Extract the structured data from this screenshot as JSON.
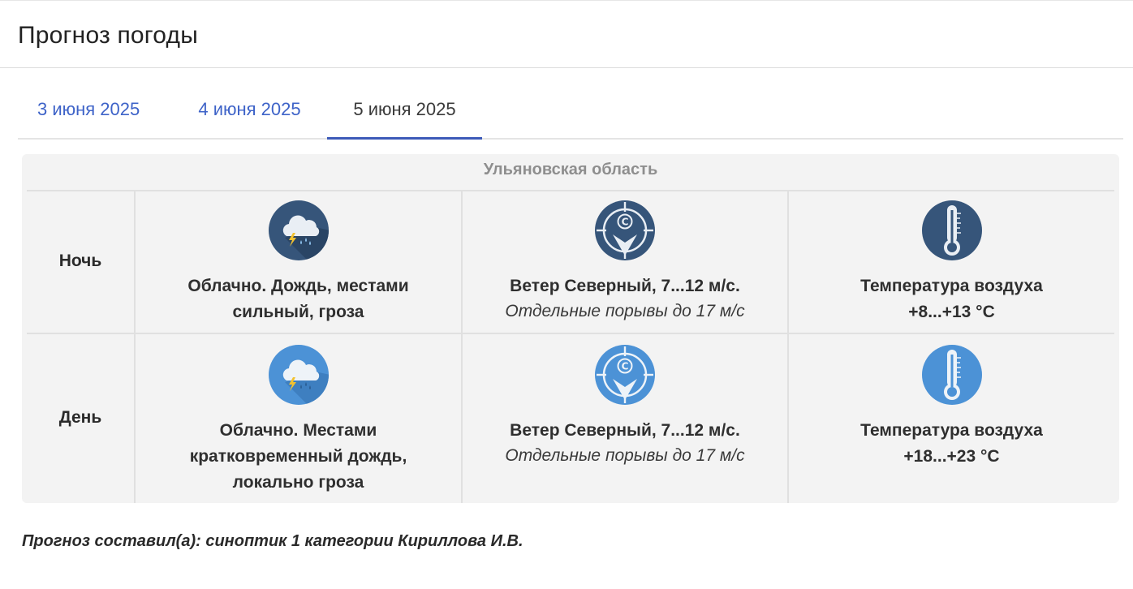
{
  "page": {
    "title": "Прогноз погоды"
  },
  "tabs": [
    {
      "label": "3 июня 2025",
      "active": false
    },
    {
      "label": "4 июня 2025",
      "active": false
    },
    {
      "label": "5 июня 2025",
      "active": true
    }
  ],
  "forecast": {
    "region": "Ульяновская область",
    "rows": [
      {
        "period": "Ночь",
        "weather": {
          "icon": "cloud-rain-thunder-icon",
          "text": "Облачно. Дождь, местами сильный, гроза"
        },
        "wind": {
          "icon": "wind-north-compass-icon",
          "direction_letter": "С",
          "text": "Ветер Северный, 7...12 м/с.",
          "gusts": "Отдельные порывы до 17 м/с"
        },
        "temperature": {
          "icon": "thermometer-icon",
          "label": "Температура воздуха",
          "value": "+8...+13 °C"
        }
      },
      {
        "period": "День",
        "weather": {
          "icon": "cloud-rain-thunder-icon",
          "text": "Облачно. Местами кратковременный дождь, локально гроза"
        },
        "wind": {
          "icon": "wind-north-compass-icon",
          "direction_letter": "С",
          "text": "Ветер Северный, 7...12 м/с.",
          "gusts": "Отдельные порывы до 17 м/с"
        },
        "temperature": {
          "icon": "thermometer-icon",
          "label": "Температура воздуха",
          "value": "+18...+23 °C"
        }
      }
    ]
  },
  "footer": {
    "author": "Прогноз составил(а): синоптик 1 категории Кириллова И.В."
  },
  "colors": {
    "tab_link": "#3e63c8",
    "tab_underline": "#3d5ab8",
    "night_icon": "#36557a",
    "day_icon": "#4c92d6",
    "panel_bg": "#f3f3f3"
  }
}
